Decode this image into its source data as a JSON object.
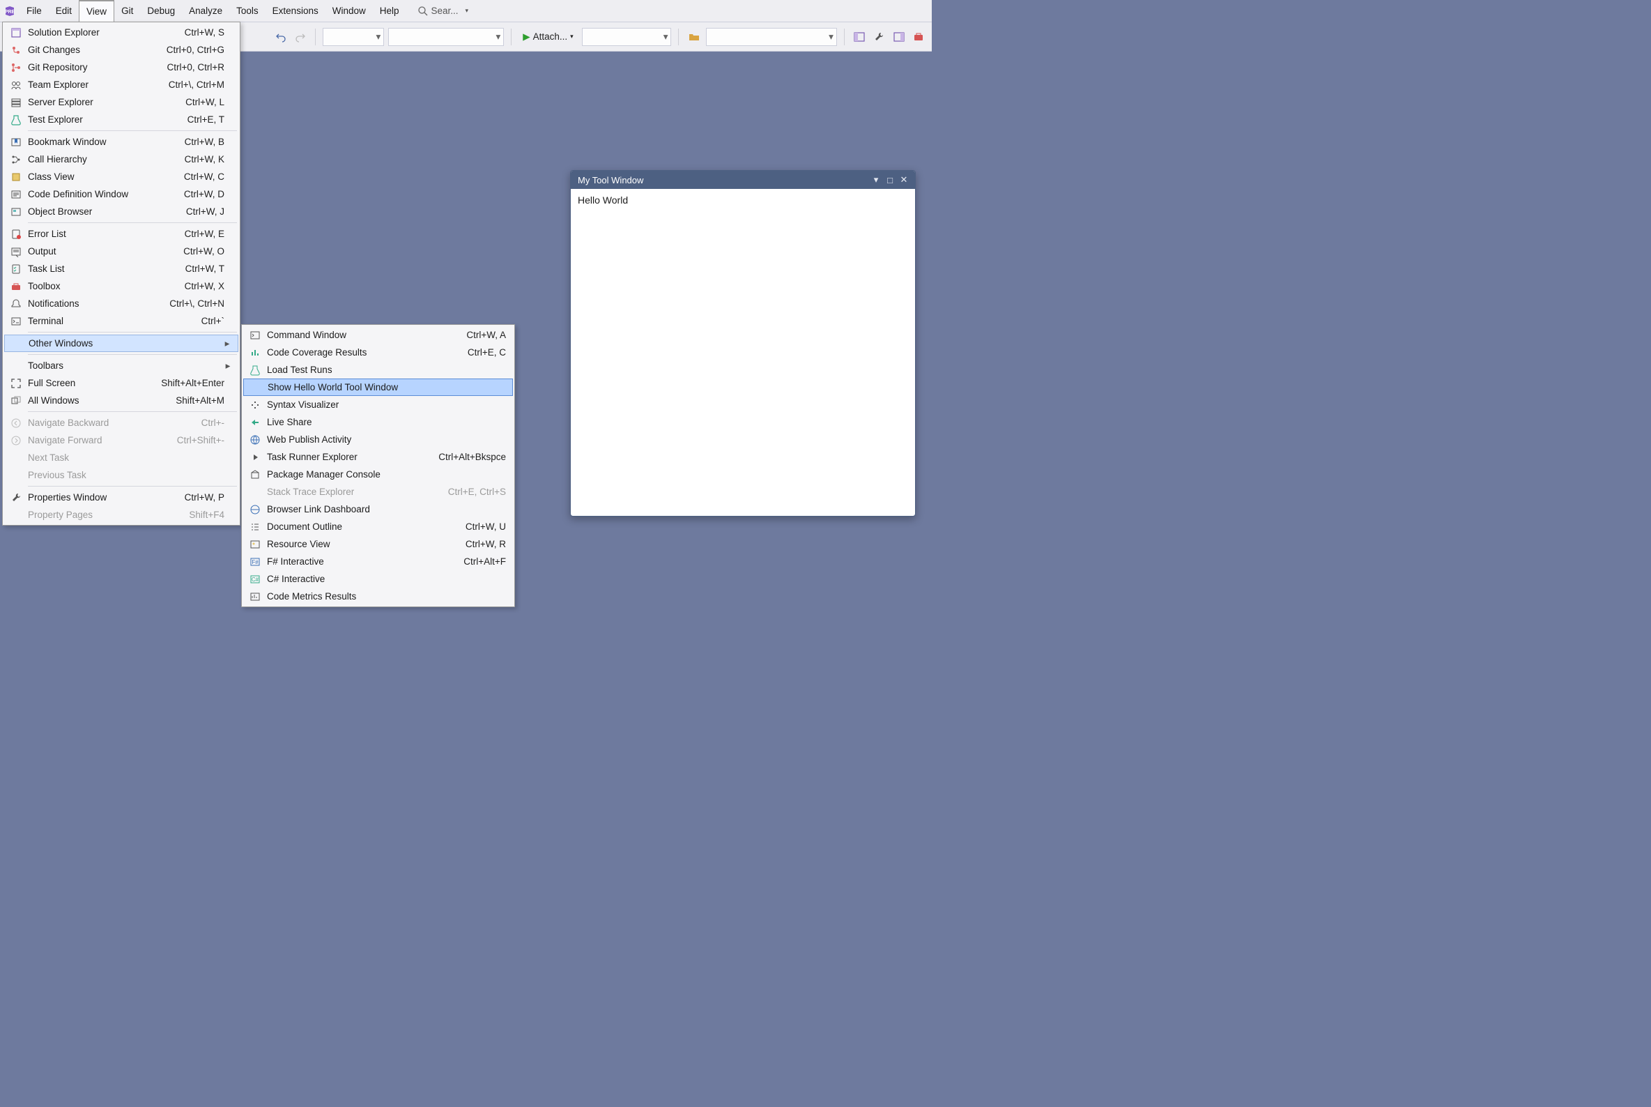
{
  "menubar": {
    "items": [
      "File",
      "Edit",
      "View",
      "Git",
      "Debug",
      "Analyze",
      "Tools",
      "Extensions",
      "Window",
      "Help"
    ],
    "active": "View",
    "search_placeholder": "Sear..."
  },
  "toolbar": {
    "attach_label": "Attach..."
  },
  "view_menu": {
    "groups": [
      [
        {
          "icon": "solution-explorer-icon",
          "label": "Solution Explorer",
          "shortcut": "Ctrl+W, S"
        },
        {
          "icon": "git-changes-icon",
          "label": "Git Changes",
          "shortcut": "Ctrl+0, Ctrl+G"
        },
        {
          "icon": "git-repo-icon",
          "label": "Git Repository",
          "shortcut": "Ctrl+0, Ctrl+R"
        },
        {
          "icon": "team-explorer-icon",
          "label": "Team Explorer",
          "shortcut": "Ctrl+\\, Ctrl+M"
        },
        {
          "icon": "server-explorer-icon",
          "label": "Server Explorer",
          "shortcut": "Ctrl+W, L"
        },
        {
          "icon": "test-explorer-icon",
          "label": "Test Explorer",
          "shortcut": "Ctrl+E, T"
        }
      ],
      [
        {
          "icon": "bookmark-icon",
          "label": "Bookmark Window",
          "shortcut": "Ctrl+W, B"
        },
        {
          "icon": "call-hierarchy-icon",
          "label": "Call Hierarchy",
          "shortcut": "Ctrl+W, K"
        },
        {
          "icon": "class-view-icon",
          "label": "Class View",
          "shortcut": "Ctrl+W, C"
        },
        {
          "icon": "code-def-icon",
          "label": "Code Definition Window",
          "shortcut": "Ctrl+W, D"
        },
        {
          "icon": "object-browser-icon",
          "label": "Object Browser",
          "shortcut": "Ctrl+W, J"
        }
      ],
      [
        {
          "icon": "error-list-icon",
          "label": "Error List",
          "shortcut": "Ctrl+W, E"
        },
        {
          "icon": "output-icon",
          "label": "Output",
          "shortcut": "Ctrl+W, O"
        },
        {
          "icon": "task-list-icon",
          "label": "Task List",
          "shortcut": "Ctrl+W, T"
        },
        {
          "icon": "toolbox-icon",
          "label": "Toolbox",
          "shortcut": "Ctrl+W, X"
        },
        {
          "icon": "notifications-icon",
          "label": "Notifications",
          "shortcut": "Ctrl+\\, Ctrl+N"
        },
        {
          "icon": "terminal-icon",
          "label": "Terminal",
          "shortcut": "Ctrl+`"
        }
      ],
      [
        {
          "icon": "",
          "label": "Other Windows",
          "shortcut": "",
          "submenu": true,
          "state": "highlight"
        }
      ],
      [
        {
          "icon": "",
          "label": "Toolbars",
          "shortcut": "",
          "submenu": true
        },
        {
          "icon": "fullscreen-icon",
          "label": "Full Screen",
          "shortcut": "Shift+Alt+Enter"
        },
        {
          "icon": "all-windows-icon",
          "label": "All Windows",
          "shortcut": "Shift+Alt+M"
        }
      ],
      [
        {
          "icon": "nav-back-icon",
          "label": "Navigate Backward",
          "shortcut": "Ctrl+-",
          "disabled": true
        },
        {
          "icon": "nav-fwd-icon",
          "label": "Navigate Forward",
          "shortcut": "Ctrl+Shift+-",
          "disabled": true
        },
        {
          "icon": "",
          "label": "Next Task",
          "shortcut": "",
          "disabled": true
        },
        {
          "icon": "",
          "label": "Previous Task",
          "shortcut": "",
          "disabled": true
        }
      ],
      [
        {
          "icon": "properties-icon",
          "label": "Properties Window",
          "shortcut": "Ctrl+W, P"
        },
        {
          "icon": "",
          "label": "Property Pages",
          "shortcut": "Shift+F4",
          "disabled": true
        }
      ]
    ]
  },
  "other_windows_menu": {
    "items": [
      {
        "icon": "command-window-icon",
        "label": "Command Window",
        "shortcut": "Ctrl+W, A"
      },
      {
        "icon": "code-coverage-icon",
        "label": "Code Coverage Results",
        "shortcut": "Ctrl+E, C"
      },
      {
        "icon": "load-test-icon",
        "label": "Load Test Runs",
        "shortcut": ""
      },
      {
        "icon": "",
        "label": "Show Hello World Tool Window",
        "shortcut": "",
        "state": "selected"
      },
      {
        "icon": "syntax-visualizer-icon",
        "label": "Syntax Visualizer",
        "shortcut": ""
      },
      {
        "icon": "live-share-icon",
        "label": "Live Share",
        "shortcut": ""
      },
      {
        "icon": "web-publish-icon",
        "label": "Web Publish Activity",
        "shortcut": ""
      },
      {
        "icon": "task-runner-icon",
        "label": "Task Runner Explorer",
        "shortcut": "Ctrl+Alt+Bkspce"
      },
      {
        "icon": "pkg-manager-icon",
        "label": "Package Manager Console",
        "shortcut": ""
      },
      {
        "icon": "",
        "label": "Stack Trace Explorer",
        "shortcut": "Ctrl+E, Ctrl+S",
        "disabled": true
      },
      {
        "icon": "browser-link-icon",
        "label": "Browser Link Dashboard",
        "shortcut": ""
      },
      {
        "icon": "doc-outline-icon",
        "label": "Document Outline",
        "shortcut": "Ctrl+W, U"
      },
      {
        "icon": "resource-view-icon",
        "label": "Resource View",
        "shortcut": "Ctrl+W, R"
      },
      {
        "icon": "fsharp-icon",
        "label": "F# Interactive",
        "shortcut": "Ctrl+Alt+F"
      },
      {
        "icon": "csharp-icon",
        "label": "C# Interactive",
        "shortcut": ""
      },
      {
        "icon": "code-metrics-icon",
        "label": "Code Metrics Results",
        "shortcut": ""
      }
    ]
  },
  "tool_window": {
    "title": "My Tool Window",
    "content": "Hello World"
  }
}
